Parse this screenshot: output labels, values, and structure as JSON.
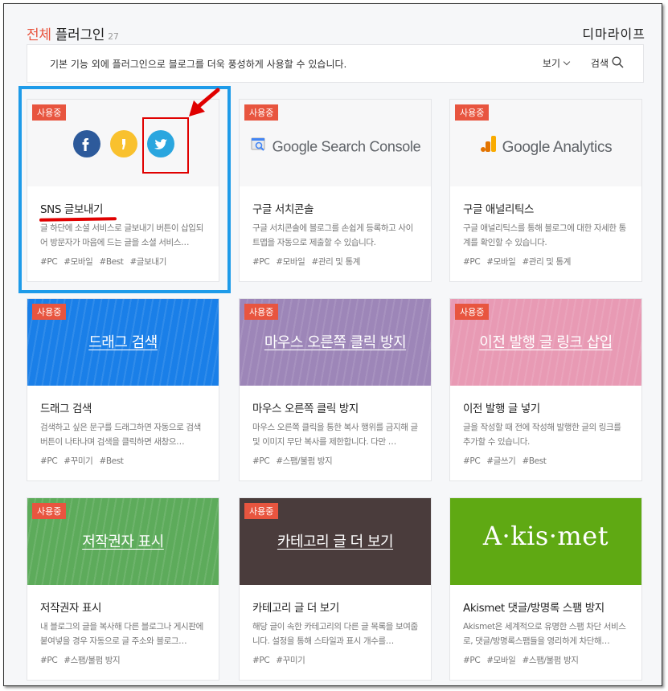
{
  "header": {
    "title_accent": "전체",
    "title_rest": " 플러그인",
    "count": "27",
    "watermark": "디마라이프"
  },
  "infobar": {
    "description": "기본 기능 외에 플러그인으로 블로그를 더욱 풍성하게 사용할 수 있습니다.",
    "view_label": "보기",
    "search_label": "검색"
  },
  "colors": {
    "accent": "#e8553f",
    "highlight_blue": "#1e9be9",
    "annotation_red": "#e00000"
  },
  "plugins": [
    {
      "badge": "사용중",
      "name": "SNS 글보내기",
      "description": "글 하단에 소셜 서비스로 글보내기 버튼이 삽입되어 방문자가 마음에 드는 글을 소셜 서비스…",
      "tags": [
        "#PC",
        "#모바일",
        "#Best",
        "#글보내기"
      ],
      "icons": [
        "facebook-icon",
        "kakaostory-icon",
        "twitter-icon"
      ]
    },
    {
      "badge": "사용중",
      "name": "구글 서치콘솔",
      "description": "구글 서치콘솔에 블로그를 손쉽게 등록하고 사이트맵을 자동으로 제출할 수 있습니다.",
      "tags": [
        "#PC",
        "#모바일",
        "#관리 및 통계"
      ],
      "banner": "Google Search Console"
    },
    {
      "badge": "사용중",
      "name": "구글 애널리틱스",
      "description": "구글 애널리틱스를 통해 블로그에 대한 자세한 통계를 확인할 수 있습니다.",
      "tags": [
        "#PC",
        "#모바일",
        "#관리 및 통계"
      ],
      "banner": "Google Analytics"
    },
    {
      "badge": "사용중",
      "name": "드래그 검색",
      "description": "검색하고 싶은 문구를 드래그하면 자동으로 검색 버튼이 나타나며 검색을 클릭하면 새창으…",
      "tags": [
        "#PC",
        "#꾸미기",
        "#Best"
      ],
      "banner": "드래그 검색",
      "color": "#1a7fe8"
    },
    {
      "badge": "사용중",
      "name": "마우스 오른쪽 클릭 방지",
      "description": "마우스 오른쪽 클릭을 통한 복사 행위를 금지해 글 및 이미지 무단 복사를 제한합니다. 다만 …",
      "tags": [
        "#PC",
        "#스팸/불펌 방지"
      ],
      "banner": "마우스 오른쪽 클릭 방지",
      "color": "#9d86b8"
    },
    {
      "badge": "사용중",
      "name": "이전 발행 글 넣기",
      "description": "글을 작성할 때 전에 작성해 발행한 글의 링크를 추가할 수 있습니다.",
      "tags": [
        "#PC",
        "#글쓰기",
        "#Best"
      ],
      "banner": "이전 발행 글 링크 삽입",
      "color": "#e89ab4"
    },
    {
      "badge": "사용중",
      "name": "저작권자 표시",
      "description": "내 블로그의 글을 복사해 다른 블로그나 게시판에 붙여넣을 경우 자동으로 글 주소와 블로그…",
      "tags": [
        "#PC",
        "#스팸/불펌 방지"
      ],
      "banner": "저작권자 표시",
      "color": "#5dab5b"
    },
    {
      "badge": "사용중",
      "name": "카테고리 글 더 보기",
      "description": "해당 글이 속한 카테고리의 다른 글 목록을 보여줍니다. 설정을 통해 스타일과 표시 개수를…",
      "tags": [
        "#PC",
        "#꾸미기"
      ],
      "banner": "카테고리 글 더 보기",
      "color": "#4a3c3c"
    },
    {
      "name": "Akismet 댓글/방명록 스팸 방지",
      "description": "Akismet은 세계적으로 유명한 스팸 차단 서비스로, 댓글/방명록스팸들을 영리하게 차단해…",
      "tags": [
        "#PC",
        "#모바일",
        "#스팸/불펌 방지"
      ],
      "banner": "A·kis·met",
      "color": "#5fa913"
    }
  ]
}
